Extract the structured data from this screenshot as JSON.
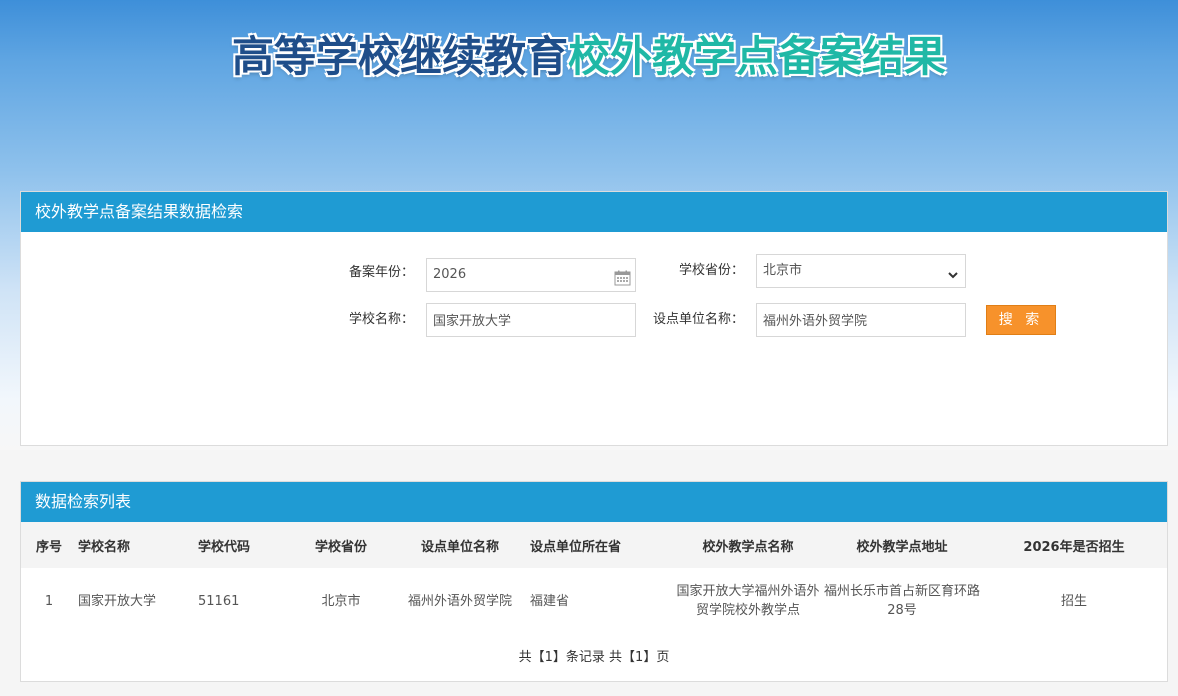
{
  "hero": {
    "title_part1": "高等学校继续教育",
    "title_part2": "校外教学点备案结果"
  },
  "search": {
    "panel_title": "校外教学点备案结果数据检索",
    "year_label": "备案年份：",
    "year_value": "2026",
    "province_label": "学校省份：",
    "province_value": "北京市",
    "school_label": "学校名称：",
    "school_value": "国家开放大学",
    "unit_label": "设点单位名称：",
    "unit_value": "福州外语外贸学院",
    "search_button": "搜 索"
  },
  "list": {
    "panel_title": "数据检索列表",
    "columns": [
      "序号",
      "学校名称",
      "学校代码",
      "学校省份",
      "设点单位名称",
      "设点单位所在省",
      "校外教学点名称",
      "校外教学点地址",
      "2026年是否招生"
    ],
    "rows": [
      {
        "index": "1",
        "school": "国家开放大学",
        "code": "51161",
        "province": "北京市",
        "unit": "福州外语外贸学院",
        "unit_province": "福建省",
        "site_name": "国家开放大学福州外语外贸学院校外教学点",
        "site_address": "福州长乐市首占新区育环路28号",
        "enrolling": "招生"
      }
    ],
    "pager": "共【1】条记录 共【1】页"
  },
  "colors": {
    "header_blue": "#1f9bd3",
    "button_orange": "#f7922b",
    "title_dark": "#1f4e8a",
    "title_teal": "#1fb8a6"
  },
  "icons": {
    "calendar": "calendar-icon",
    "dropdown": "chevron-down-icon"
  }
}
